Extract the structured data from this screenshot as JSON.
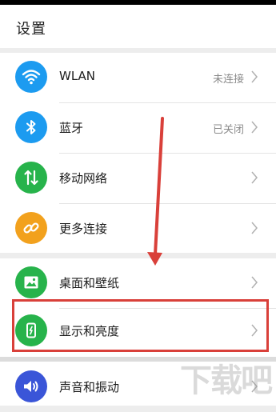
{
  "header": {
    "title": "设置"
  },
  "group1": [
    {
      "label": "WLAN",
      "status": "未连接",
      "icon": "wifi-icon",
      "color": "#1c9bf0"
    },
    {
      "label": "蓝牙",
      "status": "已关闭",
      "icon": "bluetooth-icon",
      "color": "#1c9bf0"
    },
    {
      "label": "移动网络",
      "status": "",
      "icon": "mobile-network-icon",
      "color": "#27b34b"
    },
    {
      "label": "更多连接",
      "status": "",
      "icon": "link-icon",
      "color": "#f2a11d"
    }
  ],
  "group2": [
    {
      "label": "桌面和壁纸",
      "status": "",
      "icon": "wallpaper-icon",
      "color": "#27b34b"
    },
    {
      "label": "显示和亮度",
      "status": "",
      "icon": "display-brightness-icon",
      "color": "#27b34b"
    },
    {
      "label": "声音和振动",
      "status": "",
      "icon": "sound-vibration-icon",
      "color": "#3a55d8"
    }
  ],
  "annotation": {
    "highlight_color": "#d9403a"
  },
  "watermark": {
    "text": "下载吧"
  }
}
